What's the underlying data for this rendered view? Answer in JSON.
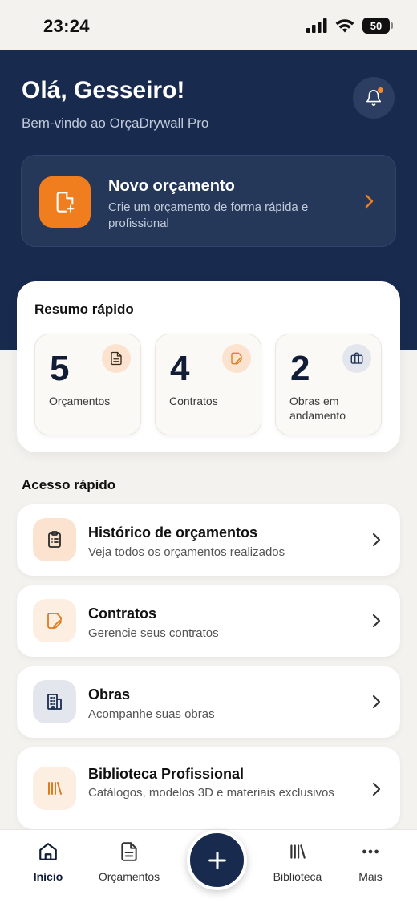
{
  "status_bar": {
    "time": "23:24",
    "battery": "50"
  },
  "header": {
    "greeting": "Olá, Gesseiro!",
    "welcome": "Bem-vindo ao OrçaDrywall Pro",
    "notification_icon": "bell-icon",
    "has_notification": true
  },
  "new_quote": {
    "title": "Novo orçamento",
    "subtitle": "Crie um orçamento de forma rápida e profissional",
    "icon": "file-plus-icon"
  },
  "summary": {
    "title": "Resumo rápido",
    "stats": [
      {
        "value": "5",
        "label": "Orçamentos",
        "icon": "document-icon"
      },
      {
        "value": "4",
        "label": "Contratos",
        "icon": "contract-edit-icon"
      },
      {
        "value": "2",
        "label": "Obras em andamento",
        "icon": "briefcase-icon"
      }
    ]
  },
  "quick_access": {
    "title": "Acesso rápido",
    "items": [
      {
        "title": "Histórico de orçamentos",
        "subtitle": "Veja todos os orçamentos realizados",
        "icon": "clipboard-list-icon"
      },
      {
        "title": "Contratos",
        "subtitle": "Gerencie seus contratos",
        "icon": "contract-edit-icon"
      },
      {
        "title": "Obras",
        "subtitle": "Acompanhe suas obras",
        "icon": "building-icon"
      },
      {
        "title": "Biblioteca Profissional",
        "subtitle": "Catálogos, modelos 3D e materiais exclusivos",
        "icon": "library-icon"
      }
    ]
  },
  "tabbar": {
    "items": [
      {
        "label": "Início",
        "icon": "home-icon",
        "active": true
      },
      {
        "label": "Orçamentos",
        "icon": "document-icon",
        "active": false
      },
      {
        "label": "Biblioteca",
        "icon": "library-icon",
        "active": false
      },
      {
        "label": "Mais",
        "icon": "more-dots-icon",
        "active": false
      }
    ],
    "fab_icon": "plus-icon"
  },
  "colors": {
    "navy": "#182b4f",
    "accent_orange": "#f07d1e",
    "background": "#f4f2ee"
  }
}
